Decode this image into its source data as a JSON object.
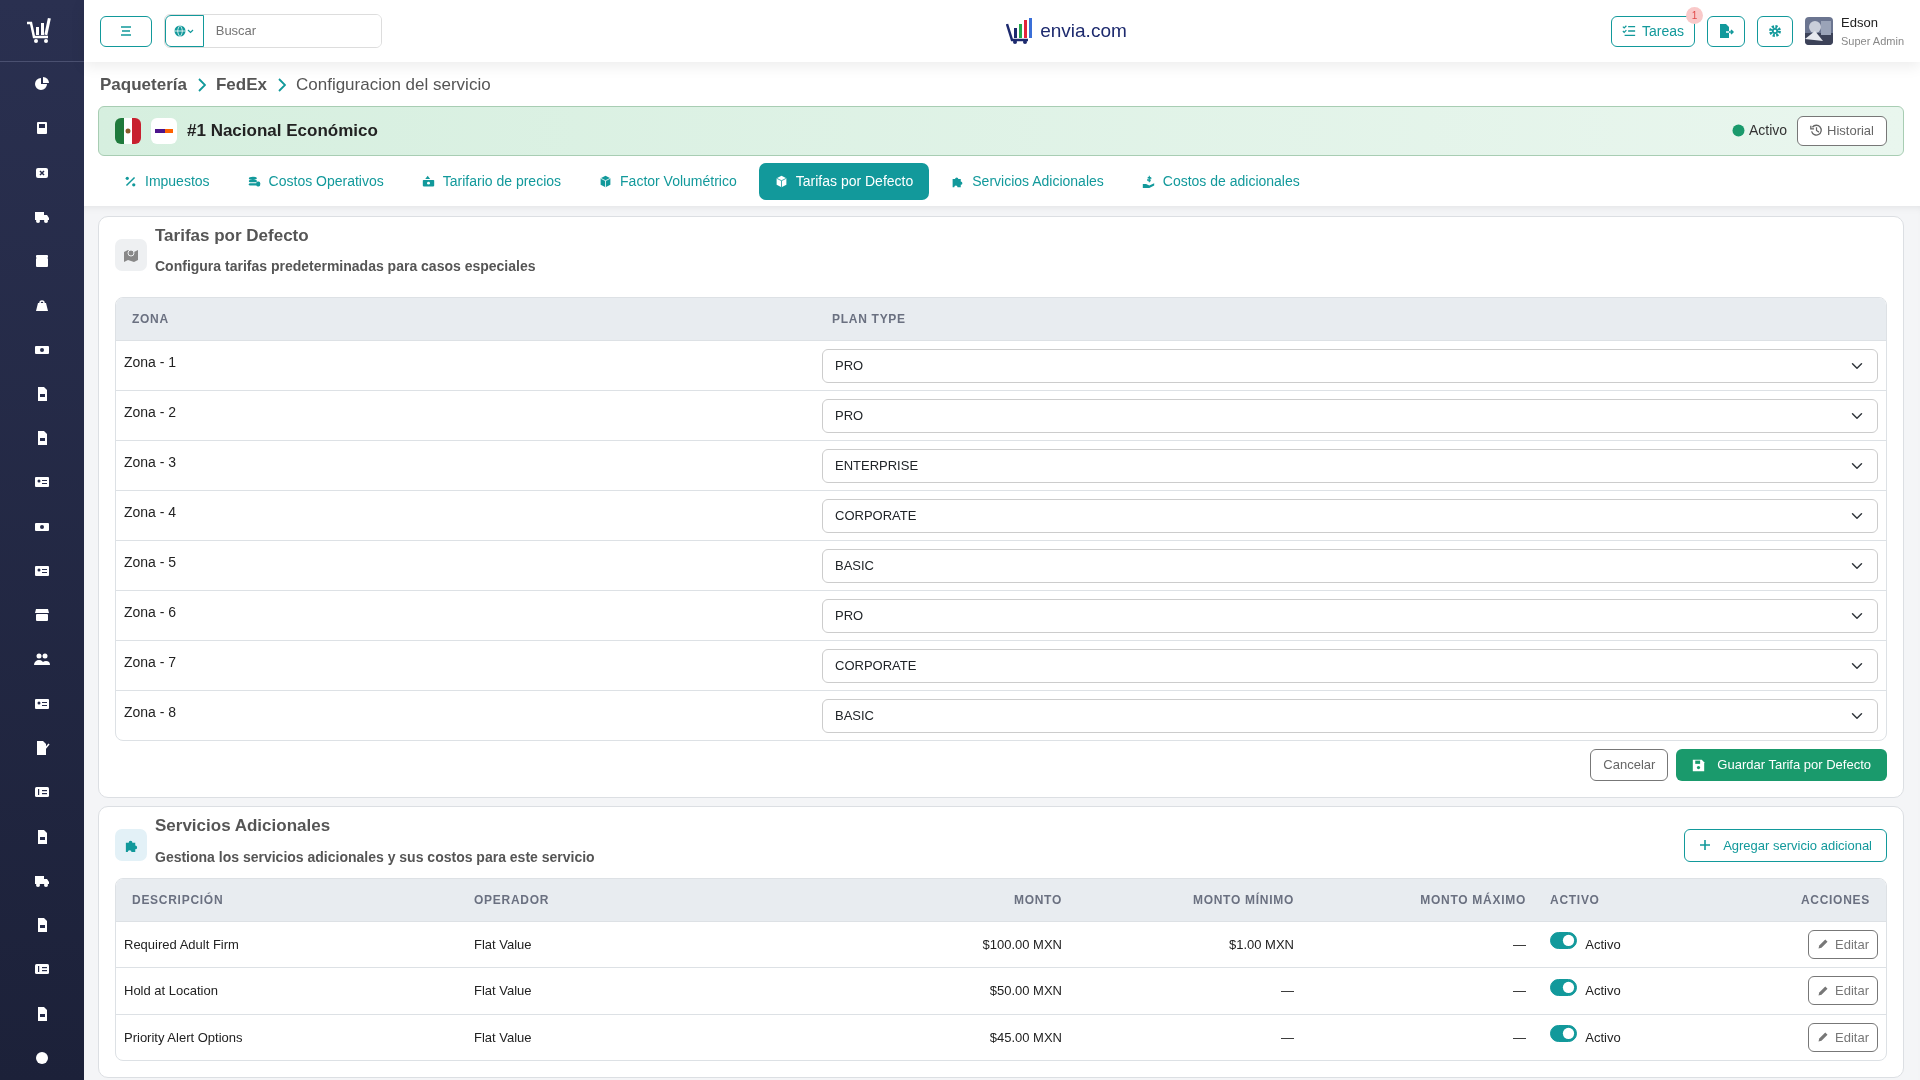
{
  "topbar": {
    "search": {
      "placeholder": "Buscar"
    },
    "logo_text": "envia.com",
    "tasks_button": "Tareas",
    "tasks_badge": "1",
    "user": {
      "name": "Edson",
      "role": "Super Admin"
    }
  },
  "breadcrumb": [
    {
      "label": "Paquetería"
    },
    {
      "label": "FedEx"
    },
    {
      "label": "Configuracion del servicio"
    }
  ],
  "service": {
    "title": "#1 Nacional Económico",
    "status": "Activo",
    "history_button": "Historial"
  },
  "tabs": [
    {
      "label": "Impuestos",
      "selected": false
    },
    {
      "label": "Costos Operativos",
      "selected": false
    },
    {
      "label": "Tarifario de precios",
      "selected": false
    },
    {
      "label": "Factor Volumétrico",
      "selected": false
    },
    {
      "label": "Tarifas por Defecto",
      "selected": true
    },
    {
      "label": "Servicios Adicionales",
      "selected": false
    },
    {
      "label": "Costos de adicionales",
      "selected": false
    }
  ],
  "default_rates": {
    "title": "Tarifas por Defecto",
    "subtitle": "Configura tarifas predeterminadas para casos especiales",
    "columns": [
      "ZONA",
      "PLAN TYPE"
    ],
    "rows": [
      {
        "zone": "Zona - 1",
        "plan": "PRO"
      },
      {
        "zone": "Zona - 2",
        "plan": "PRO"
      },
      {
        "zone": "Zona - 3",
        "plan": "ENTERPRISE"
      },
      {
        "zone": "Zona - 4",
        "plan": "CORPORATE"
      },
      {
        "zone": "Zona - 5",
        "plan": "BASIC"
      },
      {
        "zone": "Zona - 6",
        "plan": "PRO"
      },
      {
        "zone": "Zona - 7",
        "plan": "CORPORATE"
      },
      {
        "zone": "Zona - 8",
        "plan": "BASIC"
      }
    ],
    "cancel_button": "Cancelar",
    "save_button": "Guardar Tarifa por Defecto"
  },
  "additional_services": {
    "title": "Servicios Adicionales",
    "subtitle": "Gestiona los servicios adicionales y sus costos para este servicio",
    "add_button": "Agregar servicio adicional",
    "columns": [
      "DESCRIPCIÓN",
      "OPERADOR",
      "MONTO",
      "MONTO MÍNIMO",
      "MONTO MÁXIMO",
      "ACTIVO",
      "ACCIONES"
    ],
    "rows": [
      {
        "description": "Required Adult Firm",
        "operator": "Flat Value",
        "amount": "$100.00 MXN",
        "min": "$1.00 MXN",
        "max": "—",
        "active": true,
        "status": "Activo",
        "action": "Editar"
      },
      {
        "description": "Hold at Location",
        "operator": "Flat Value",
        "amount": "$50.00 MXN",
        "min": "—",
        "max": "—",
        "active": true,
        "status": "Activo",
        "action": "Editar"
      },
      {
        "description": "Priority Alert Options",
        "operator": "Flat Value",
        "amount": "$45.00 MXN",
        "min": "—",
        "max": "—",
        "active": true,
        "status": "Activo",
        "action": "Editar"
      }
    ]
  }
}
